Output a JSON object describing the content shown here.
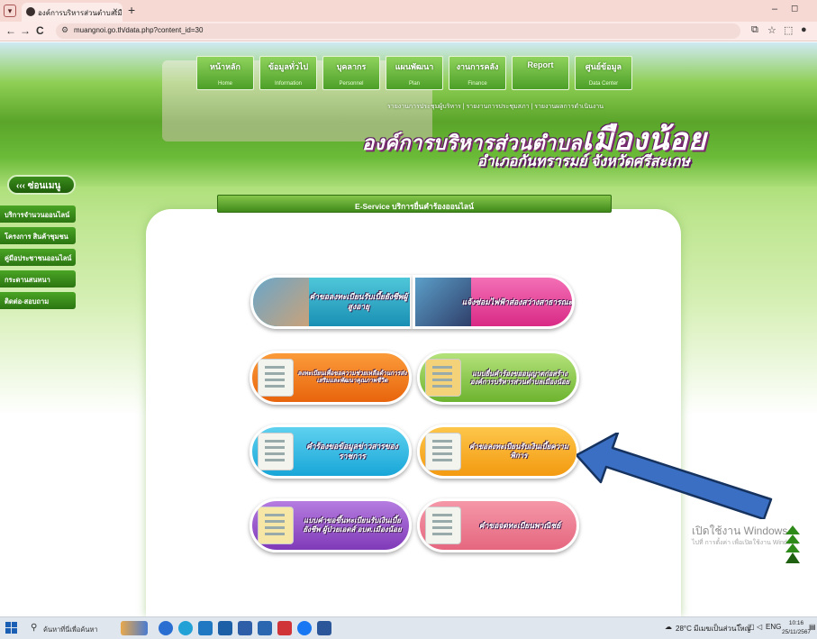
{
  "browser": {
    "tab_title": "องค์การบริหารส่วนตำบลเมืองน้อย อำ",
    "tab_close": "×",
    "new_tab": "+",
    "url": "muangnoi.go.th/data.php?content_id=30",
    "back": "←",
    "forward": "→",
    "reload": "C"
  },
  "top_menu": [
    {
      "th": "หน้าหลัก",
      "en": "Home"
    },
    {
      "th": "ข้อมูลทั่วไป",
      "en": "Information"
    },
    {
      "th": "บุคลากร",
      "en": "Personnel"
    },
    {
      "th": "แผนพัฒนา",
      "en": "Plan"
    },
    {
      "th": "งานการคลัง",
      "en": "Finance"
    },
    {
      "th": "Report",
      "en": ""
    },
    {
      "th": "ศูนย์ข้อมูล",
      "en": "Data Center"
    }
  ],
  "sub_links": "รายงานการประชุมผู้บริหาร | รายงานการประชุมสภา | รายงานผลการดำเนินงาน",
  "org": {
    "title_prefix": "องค์การบริหารส่วนตำบล",
    "title_name": "เมืองน้อย",
    "subtitle": "อำเภอกันทรารมย์ จังหวัดศรีสะเกษ"
  },
  "hide_menu_label": "‹‹‹ ซ่อนเมนู",
  "side_nav": [
    "บริการจำนวนออนไลน์",
    "โครงการ สินค้าชุมชน",
    "คู่มือประชาชนออนไลน์",
    "กระดานสนทนา",
    "ติดต่อ-สอบถาม"
  ],
  "eservice_title": "E-Service บริการยื่นคำร้องออนไลน์",
  "services": [
    "คำขอลงทะเบียนรับเบี้ยยังชีพผู้สูงอายุ",
    "แจ้งซ่อมไฟฟ้าส่องสว่างสาธารณะ",
    "ลงทะเบียนเพื่อขอความช่วยเหลือด้านการส่งเสริมและพัฒนาคุณภาพชีวิต",
    "แบบยื่นคำร้องขออนุญาตก่อสร้าง องค์การบริหารส่วนตำบลเมืองน้อย",
    "คำร้องขอข้อมูลข่าวสารของราชการ",
    "คำขอลงทะเบียนรับเงินเบี้ยความพิการ",
    "แบบคำขอขึ้นทะเบียนรับเงินเบี้ยยังชีพ ผู้ป่วยเอดส์ อบต.เมืองน้อย",
    "คำขอจดทะเบียนพาณิชย์"
  ],
  "watermark": {
    "title": "เปิดใช้งาน Windows",
    "subtitle": "ไปที่ การตั้งค่า เพื่อเปิดใช้งาน Windows"
  },
  "taskbar": {
    "search_placeholder": "ค้นหาที่นี่เพื่อค้นหา",
    "weather": "28°C มีเมฆเป็นส่วนใหญ่",
    "lang": "ENG",
    "time": "10:16",
    "date": "25/11/2567"
  },
  "colors": {
    "accent_green": "#4c9f28",
    "arrow_blue": "#3a6fc4",
    "title_purple": "#5c1a60"
  }
}
